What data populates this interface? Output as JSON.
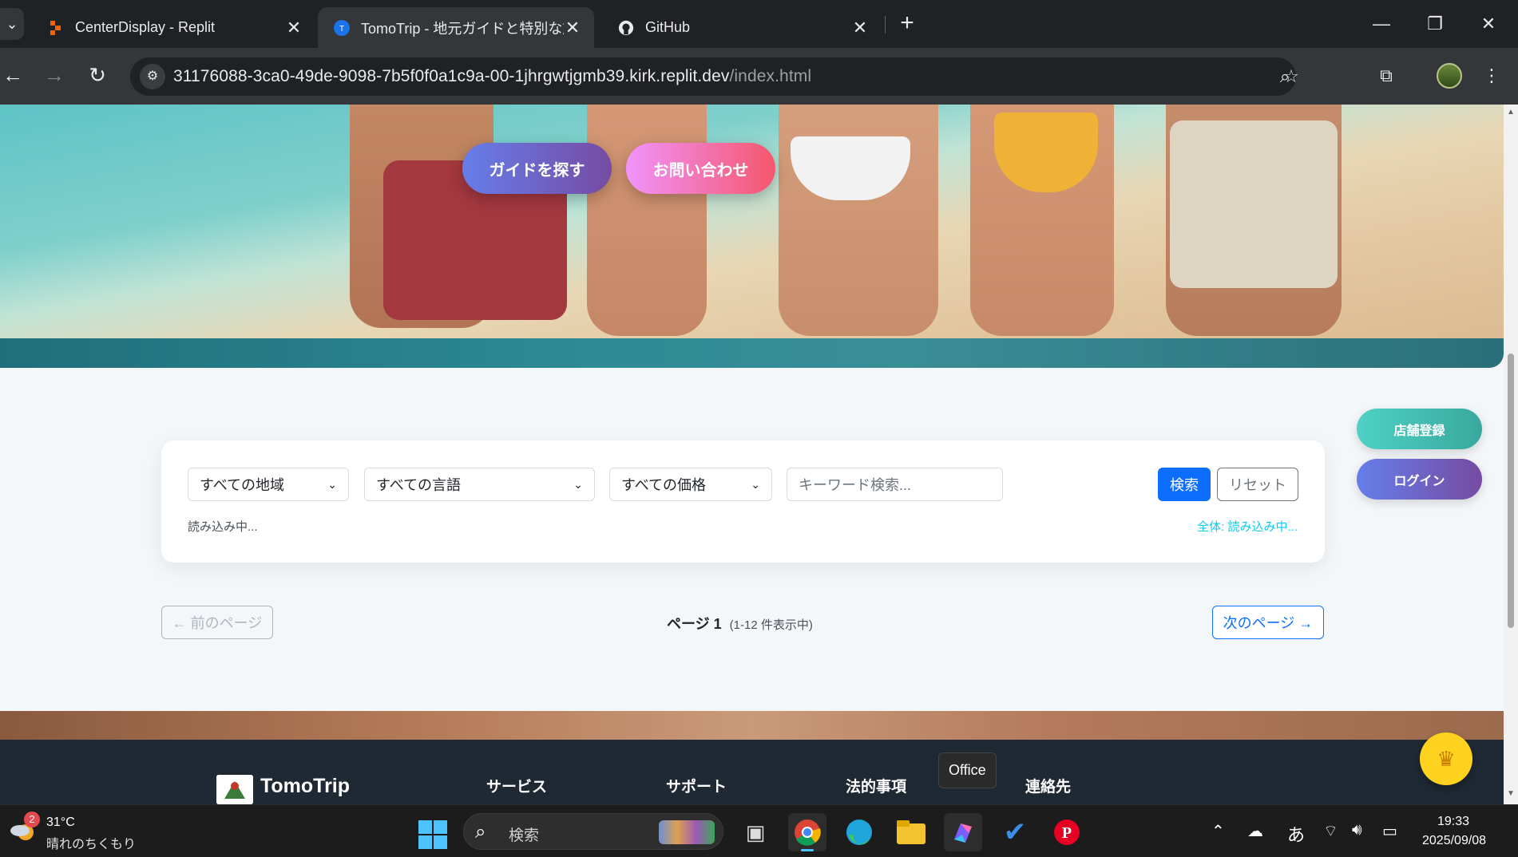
{
  "browser": {
    "tabs": [
      {
        "title": "CenterDisplay - Replit",
        "active": false
      },
      {
        "title": "TomoTrip - 地元ガイドと特別な旅",
        "active": true
      },
      {
        "title": "GitHub",
        "active": false
      }
    ],
    "url_host": "31176088-3ca0-49de-9098-7b5f0f0a1c9a-00-1jhrgwtjgmb39.kirk.replit.dev",
    "url_path": "/index.html"
  },
  "hero": {
    "guide_button": "ガイドを探す",
    "contact_button": "お問い合わせ"
  },
  "search": {
    "region_select": "すべての地域",
    "language_select": "すべての言語",
    "price_select": "すべての価格",
    "keyword_placeholder": "キーワード検索...",
    "search_button": "検索",
    "reset_button": "リセット",
    "loading_text": "読み込み中...",
    "total_text": "全体: 読み込み中..."
  },
  "side_buttons": {
    "store_register": "店舗登録",
    "login": "ログイン"
  },
  "pagination": {
    "prev": "← 前のページ",
    "page_label": "ページ 1",
    "range_label": "(1-12 件表示中)",
    "next": "次のページ →"
  },
  "footer": {
    "brand": "TomoTrip",
    "columns": [
      "サービス",
      "サポート",
      "法的事項",
      "連絡先"
    ]
  },
  "tooltip": "Office",
  "taskbar": {
    "weather_badge": "2",
    "temperature": "31°C",
    "weather": "晴れのちくもり",
    "search_placeholder": "検索",
    "ime": "あ",
    "time": "19:33",
    "date": "2025/09/08"
  },
  "colors": {
    "primary_blue": "#0d6efd",
    "info_cyan": "#0dcaf0",
    "guide_gradient": [
      "#667eea",
      "#764ba2"
    ],
    "contact_gradient": [
      "#f093fb",
      "#f5576c"
    ],
    "store_gradient": [
      "#4fd1c5",
      "#38a89d"
    ]
  }
}
